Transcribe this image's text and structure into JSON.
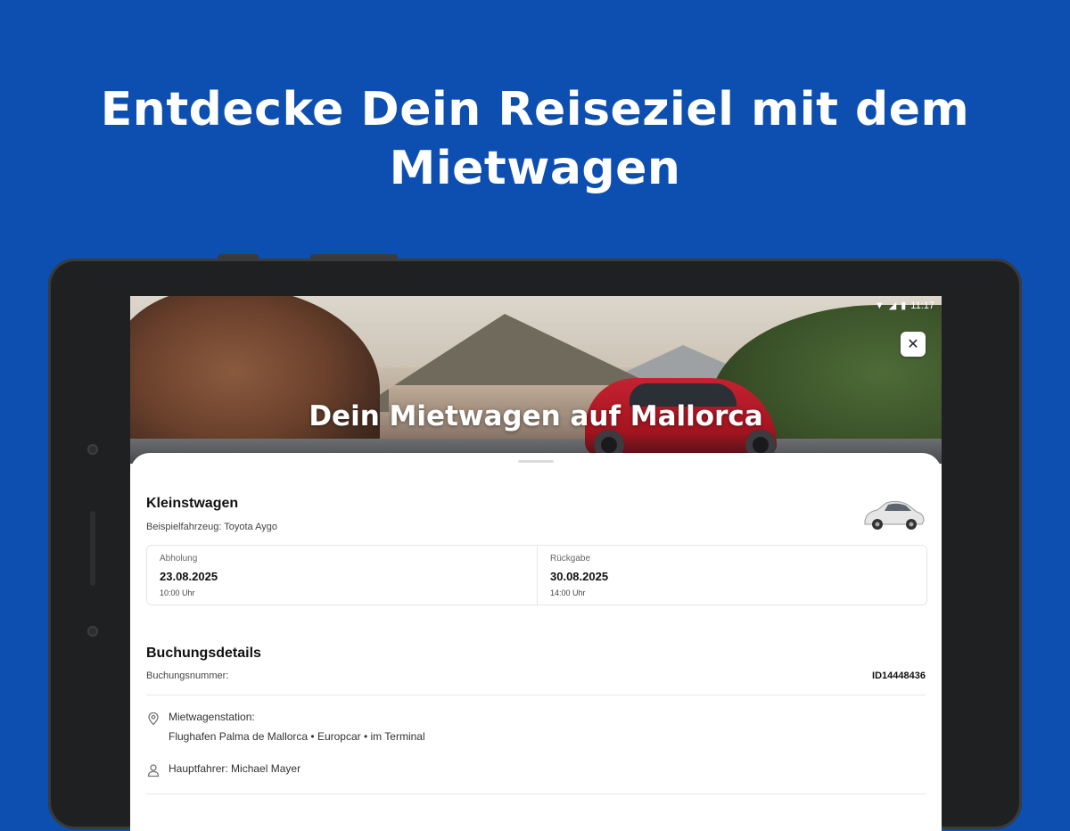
{
  "headline": {
    "line1": "Entdecke Dein Reiseziel mit dem",
    "line2": "Mietwagen"
  },
  "status_bar": {
    "time": "11:17"
  },
  "hero": {
    "title": "Dein Mietwagen auf Mallorca",
    "close_icon": "close-icon"
  },
  "vehicle": {
    "category": "Kleinstwagen",
    "example": "Beispielfahrzeug: Toyota Aygo"
  },
  "pickup": {
    "label": "Abholung",
    "date": "23.08.2025",
    "time": "10:00 Uhr"
  },
  "return": {
    "label": "Rückgabe",
    "date": "30.08.2025",
    "time": "14:00 Uhr"
  },
  "booking": {
    "title": "Buchungsdetails",
    "number_label": "Buchungsnummer:",
    "number": "ID14448436",
    "station_label": "Mietwagenstation:",
    "station": "Flughafen Palma de Mallorca • Europcar • im Terminal",
    "driver": "Hauptfahrer: Michael Mayer"
  },
  "colors": {
    "background": "#0d4fb0",
    "sheet": "#ffffff"
  }
}
